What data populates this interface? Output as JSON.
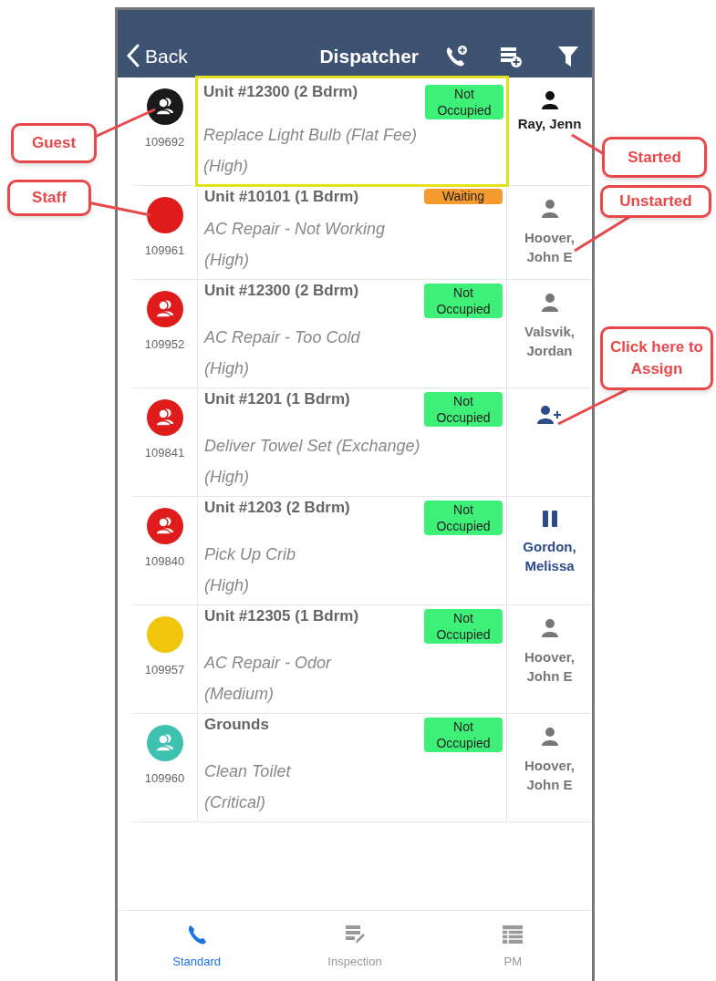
{
  "header": {
    "back": "Back",
    "title": "Dispatcher"
  },
  "rows": [
    {
      "avatar": {
        "kind": "guest",
        "color": "#1a1a1a"
      },
      "number": "109692",
      "unit": "Unit #12300 (2 Bdrm)",
      "badge": {
        "kind": "not_occupied",
        "text": "Not Occupied"
      },
      "task": "Replace Light Bulb (Flat Fee)",
      "priority": "(High)",
      "highlighted": true,
      "assignee": {
        "kind": "started",
        "name": "Ray, Jenn"
      }
    },
    {
      "avatar": {
        "kind": "staff",
        "color": "#e01b1b"
      },
      "number": "109961",
      "unit": "Unit #10101 (1 Bdrm)",
      "badge": {
        "kind": "waiting",
        "text": "Waiting"
      },
      "task": "AC Repair - Not Working",
      "priority": "(High)",
      "highlighted": false,
      "assignee": {
        "kind": "unstarted",
        "name": "Hoover, John E"
      }
    },
    {
      "avatar": {
        "kind": "guest",
        "color": "#e01b1b"
      },
      "number": "109952",
      "unit": "Unit #12300 (2 Bdrm)",
      "badge": {
        "kind": "not_occupied",
        "text": "Not Occupied"
      },
      "task": "AC Repair - Too Cold",
      "priority": "(High)",
      "highlighted": false,
      "assignee": {
        "kind": "unstarted",
        "name": "Valsvik, Jordan"
      }
    },
    {
      "avatar": {
        "kind": "guest",
        "color": "#e01b1b"
      },
      "number": "109841",
      "unit": "Unit #1201 (1 Bdrm)",
      "badge": {
        "kind": "not_occupied",
        "text": "Not Occupied"
      },
      "task": "Deliver Towel Set (Exchange)",
      "priority": "(High)",
      "highlighted": false,
      "assignee": {
        "kind": "unassigned"
      }
    },
    {
      "avatar": {
        "kind": "guest",
        "color": "#e01b1b"
      },
      "number": "109840",
      "unit": "Unit #1203 (2 Bdrm)",
      "badge": {
        "kind": "not_occupied",
        "text": "Not Occupied"
      },
      "task": "Pick Up Crib",
      "priority": "(High)",
      "highlighted": false,
      "assignee": {
        "kind": "paused",
        "name": "Gordon, Melissa"
      }
    },
    {
      "avatar": {
        "kind": "staff",
        "color": "#f0c60c"
      },
      "number": "109957",
      "unit": "Unit #12305 (1 Bdrm)",
      "badge": {
        "kind": "not_occupied",
        "text": "Not Occupied"
      },
      "task": "AC Repair - Odor",
      "priority": "(Medium)",
      "highlighted": false,
      "assignee": {
        "kind": "unstarted",
        "name": "Hoover, John E"
      }
    },
    {
      "avatar": {
        "kind": "guest",
        "color": "#3fc1b0"
      },
      "number": "109960",
      "unit": "Grounds",
      "badge": {
        "kind": "not_occupied",
        "text": "Not Occupied"
      },
      "task": "Clean Toilet",
      "priority": "(Critical)",
      "highlighted": false,
      "assignee": {
        "kind": "unstarted",
        "name": "Hoover, John E"
      }
    }
  ],
  "tabs": [
    {
      "kind": "standard",
      "label": "Standard",
      "selected": true
    },
    {
      "kind": "inspection",
      "label": "Inspection",
      "selected": false
    },
    {
      "kind": "pm",
      "label": "PM",
      "selected": false
    }
  ],
  "annotations": [
    {
      "text": "Guest"
    },
    {
      "text": "Staff"
    },
    {
      "text": "Started"
    },
    {
      "text": "Unstarted"
    },
    {
      "text": "Click here to Assign"
    }
  ]
}
